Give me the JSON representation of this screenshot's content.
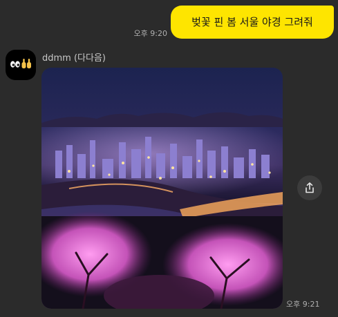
{
  "chat": {
    "outgoing": {
      "text": "벚꽃 핀 봄 서울 야경 그려줘",
      "time": "오후 9:20"
    },
    "incoming": {
      "sender_name": "ddmm (다다음)",
      "avatar_icon": "eyes-pointing-emoji-icon",
      "image_subject": "spring-seoul-night-cityscape-with-cherry-blossoms",
      "time": "오후 9:21",
      "share_icon": "share-upload-icon"
    }
  },
  "colors": {
    "background": "#2b2b2b",
    "bubble": "#fee500",
    "timestamp": "#b0b0b0",
    "sender": "#c8c8c8"
  }
}
